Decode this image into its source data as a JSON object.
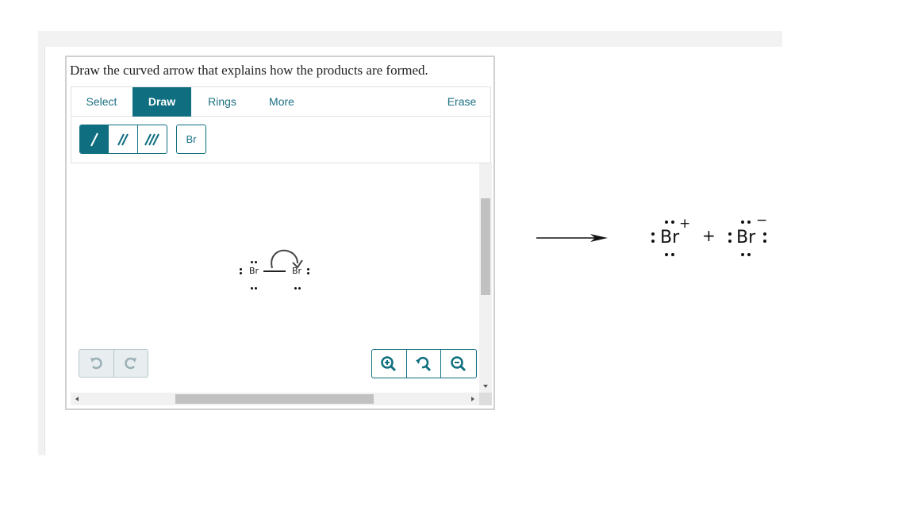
{
  "question": {
    "prompt": "Draw the curved arrow that explains how the products are formed."
  },
  "toolbar": {
    "tabs": [
      {
        "label": "Select",
        "active": false
      },
      {
        "label": "Draw",
        "active": true
      },
      {
        "label": "Rings",
        "active": false
      },
      {
        "label": "More",
        "active": false
      }
    ],
    "erase_label": "Erase",
    "bond_buttons": [
      {
        "icon": "single-bond-icon",
        "active": true
      },
      {
        "icon": "double-bond-icon",
        "active": false
      },
      {
        "icon": "triple-bond-icon",
        "active": false
      }
    ],
    "atom_button_label": "Br"
  },
  "canvas": {
    "left_atom": "Br",
    "right_atom": "Br",
    "curved_arrow": "curved-arrow-icon"
  },
  "controls": {
    "undo_icon": "undo-icon",
    "redo_icon": "redo-icon",
    "zoom_in_icon": "zoom-in-icon",
    "reset_zoom_icon": "reset-zoom-icon",
    "zoom_out_icon": "zoom-out-icon"
  },
  "reaction": {
    "arrow_icon": "reaction-arrow-icon",
    "product1": {
      "symbol": "Br",
      "charge": "+"
    },
    "plus": "+",
    "product2": {
      "symbol": "Br",
      "charge": "−"
    }
  },
  "colors": {
    "accent": "#0f6f80",
    "tab_text": "#1b7083",
    "disabled_bg": "#e8eef0"
  }
}
